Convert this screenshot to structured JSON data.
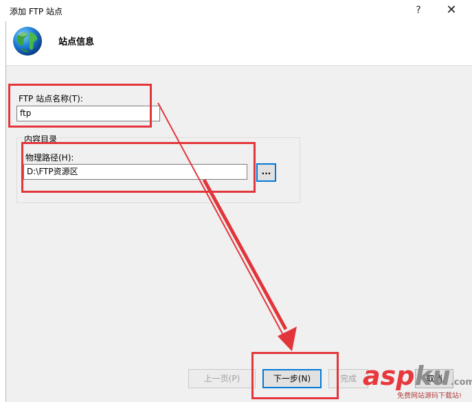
{
  "window": {
    "title": "添加 FTP 站点",
    "help_glyph": "?",
    "close_glyph": "✕"
  },
  "header": {
    "section_title": "站点信息",
    "icon": "globe-icon"
  },
  "form": {
    "site_name_label": "FTP 站点名称(T):",
    "site_name_value": "ftp",
    "content_group_label": "内容目录",
    "physical_path_label": "物理路径(H):",
    "physical_path_value": "D:\\FTP资源区",
    "browse_label": "..."
  },
  "footer": {
    "prev_label": "上一页(P)",
    "next_label": "下一步(N)",
    "finish_label": "完成",
    "cancel_label": "取消"
  },
  "watermark": {
    "brand_a": "asp",
    "brand_b": "ku",
    "brand_suffix": ".com",
    "tagline": "免费网站源码下载站!"
  },
  "colors": {
    "annotation_red": "#e2353a",
    "focus_blue": "#0078d7"
  }
}
